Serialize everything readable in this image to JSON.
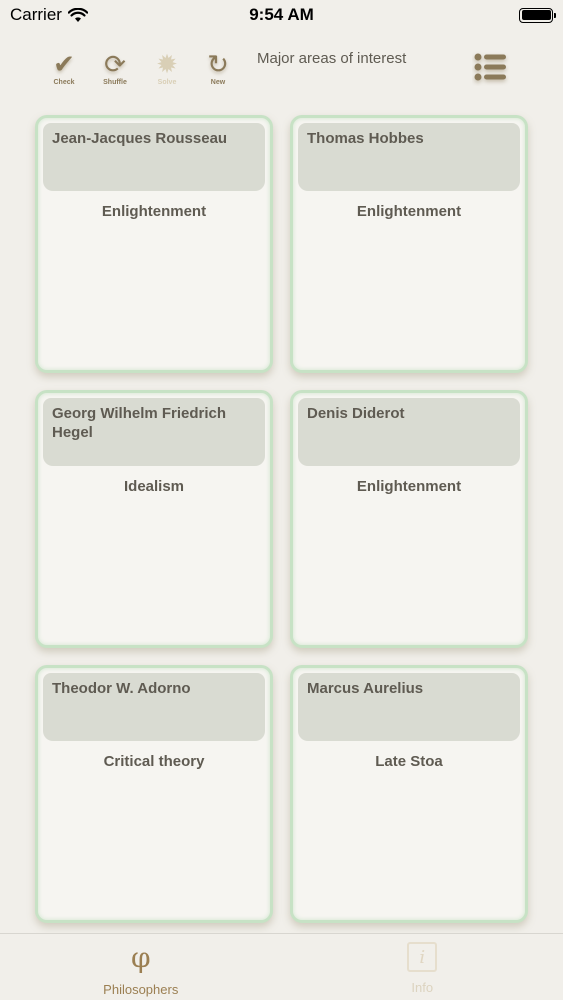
{
  "status": {
    "carrier": "Carrier",
    "time": "9:54 AM"
  },
  "toolbar": {
    "title": "Major areas of interest",
    "tools": [
      {
        "label": "Check",
        "icon": "check-icon",
        "glyph": "✔",
        "enabled": true
      },
      {
        "label": "Shuffle",
        "icon": "shuffle-icon",
        "glyph": "⟳",
        "enabled": true
      },
      {
        "label": "Solve",
        "icon": "solve-icon",
        "glyph": "✹",
        "enabled": false
      },
      {
        "label": "New",
        "icon": "new-icon",
        "glyph": "↻",
        "enabled": true
      }
    ]
  },
  "cards": [
    {
      "name": "Jean-Jacques Rousseau",
      "area": "Enlightenment"
    },
    {
      "name": "Thomas Hobbes",
      "area": "Enlightenment"
    },
    {
      "name": "Georg Wilhelm Friedrich Hegel",
      "area": "Idealism"
    },
    {
      "name": "Denis Diderot",
      "area": "Enlightenment"
    },
    {
      "name": "Theodor W. Adorno",
      "area": "Critical theory"
    },
    {
      "name": "Marcus Aurelius",
      "area": "Late Stoa"
    }
  ],
  "tabs": [
    {
      "label": "Philosophers",
      "icon": "phi-icon",
      "glyph": "φ",
      "active": true
    },
    {
      "label": "Info",
      "icon": "info-icon",
      "glyph": "i",
      "active": false
    }
  ],
  "colors": {
    "card_border": "#c7e2c5",
    "accent": "#8b7a5a",
    "background": "#f1efea"
  }
}
